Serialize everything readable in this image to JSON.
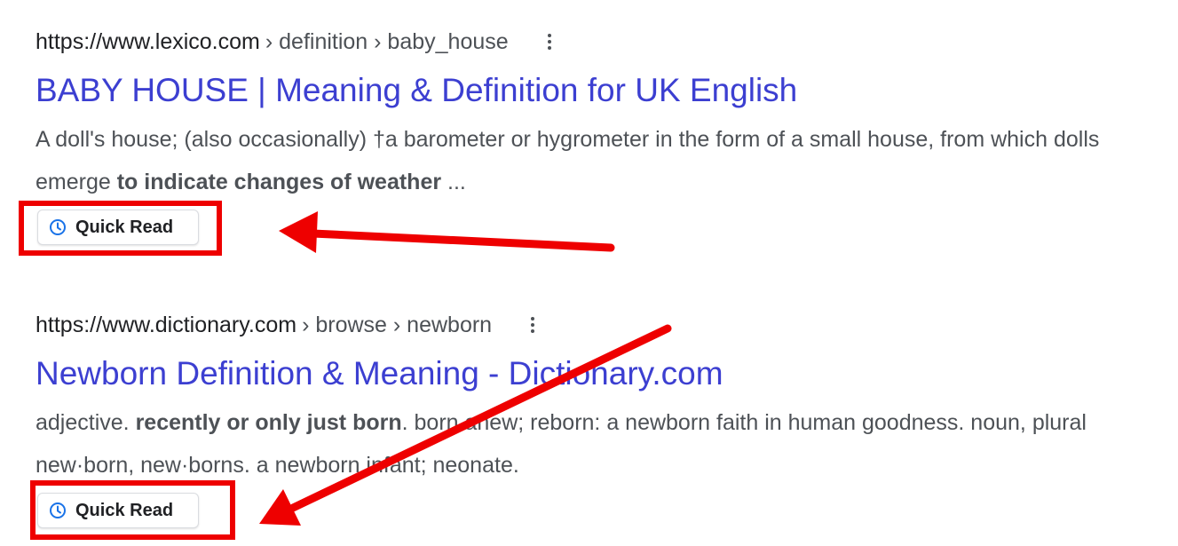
{
  "results": [
    {
      "domain": "https://www.lexico.com",
      "path": "› definition › baby_house",
      "title": "BABY HOUSE | Meaning & Definition for UK English",
      "snippet": {
        "pre": "A doll's house; (also occasionally) †a barometer or hygrometer in the form of a small house, from which dolls emerge ",
        "bold": "to indicate changes of weather",
        "post": " ..."
      },
      "quick_read_label": "Quick Read"
    },
    {
      "domain": "https://www.dictionary.com",
      "path": "› browse › newborn",
      "title": "Newborn Definition & Meaning - Dictionary.com",
      "snippet": {
        "pre": "adjective. ",
        "bold": "recently or only just born",
        "post": ". born anew; reborn: a newborn faith in human goodness. noun, plural new·born, new·borns. a newborn infant; neonate."
      },
      "quick_read_label": "Quick Read"
    }
  ],
  "colors": {
    "link": "#3c3fd1",
    "annotation": "#ee0000",
    "icon": "#1a73e8"
  },
  "icons": {
    "menu": "more-vert-icon",
    "quick_read": "clock-icon"
  }
}
